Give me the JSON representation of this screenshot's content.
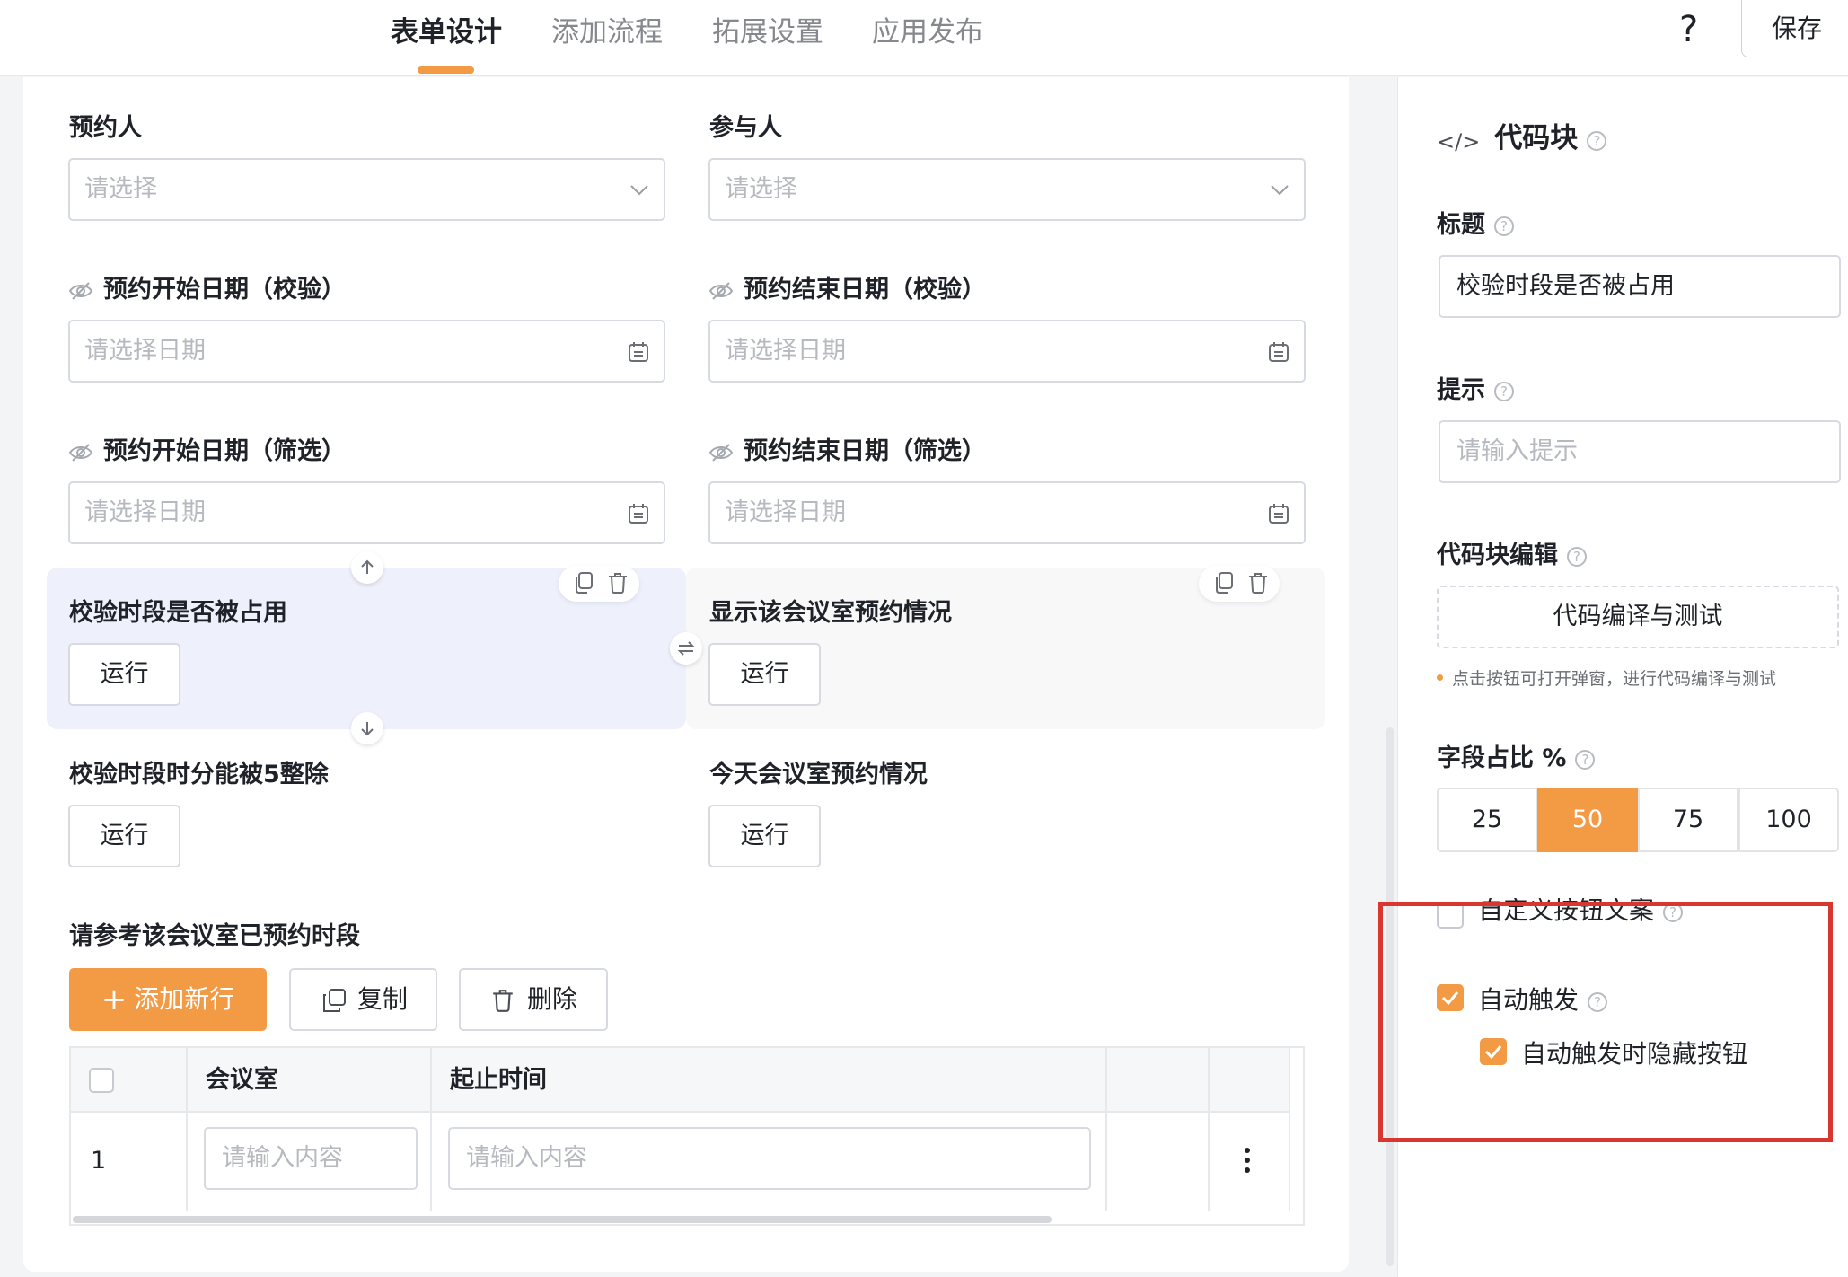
{
  "tabs": [
    {
      "label": "表单设计",
      "active": true
    },
    {
      "label": "添加流程",
      "active": false
    },
    {
      "label": "拓展设置",
      "active": false
    },
    {
      "label": "应用发布",
      "active": false
    }
  ],
  "header": {
    "help_label": "?",
    "save_label": "保存"
  },
  "form": {
    "booker": {
      "label": "预约人",
      "placeholder": "请选择"
    },
    "participants": {
      "label": "参与人",
      "placeholder": "请选择"
    },
    "start_date_check": {
      "label": "预约开始日期（校验）",
      "placeholder": "请选择日期"
    },
    "end_date_check": {
      "label": "预约结束日期（校验）",
      "placeholder": "请选择日期"
    },
    "start_date_filter": {
      "label": "预约开始日期（筛选）",
      "placeholder": "请选择日期"
    },
    "end_date_filter": {
      "label": "预约结束日期（筛选）",
      "placeholder": "请选择日期"
    },
    "code_blocks": [
      {
        "label": "校验时段是否被占用",
        "button": "运行"
      },
      {
        "label": "显示该会议室预约情况",
        "button": "运行"
      },
      {
        "label": "校验时段时分能被5整除",
        "button": "运行"
      },
      {
        "label": "今天会议室预约情况",
        "button": "运行"
      }
    ],
    "subtable": {
      "label": "请参考该会议室已预约时段",
      "add_label": "添加新行",
      "copy_label": "复制",
      "delete_label": "删除",
      "columns": [
        "会议室",
        "起止时间"
      ],
      "rows": [
        {
          "index": "1",
          "room_placeholder": "请输入内容",
          "time_placeholder": "请输入内容"
        }
      ]
    }
  },
  "panel": {
    "title": "代码块",
    "title_field": {
      "label": "标题",
      "value": "校验时段是否被占用"
    },
    "hint_field": {
      "label": "提示",
      "placeholder": "请输入提示"
    },
    "code_edit": {
      "label": "代码块编辑",
      "button": "代码编译与测试",
      "hint": "点击按钮可打开弹窗，进行代码编译与测试"
    },
    "width": {
      "label": "字段占比 %",
      "options": [
        "25",
        "50",
        "75",
        "100"
      ],
      "selected": "50"
    },
    "custom_text": {
      "label": "自定义按钮文案",
      "checked": false
    },
    "auto_trigger": {
      "label": "自动触发",
      "checked": true
    },
    "hide_on_auto": {
      "label": "自动触发时隐藏按钮",
      "checked": true
    }
  },
  "colors": {
    "accent": "#f39a45",
    "highlight_box": "#d7372f",
    "selected_card": "#eef1fb"
  }
}
